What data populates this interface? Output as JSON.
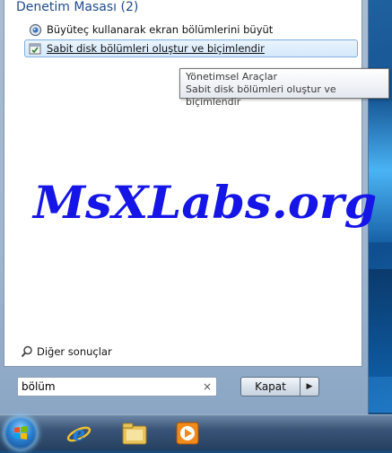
{
  "results": {
    "group_header": "Denetim Masası (2)",
    "items": [
      {
        "label": "Büyüteç kullanarak ekran bölümlerini büyüt",
        "icon": "magnifier-icon"
      },
      {
        "label": "Sabit disk bölümleri oluştur ve biçimlendir",
        "icon": "admin-tools-icon",
        "selected": true
      }
    ]
  },
  "tooltip": {
    "line1": "Yönetimsel Araçlar",
    "line2": "Sabit disk bölümleri oluştur ve biçimlendir"
  },
  "watermark": "MsXLabs.org",
  "more_results": "Diğer sonuçlar",
  "search": {
    "value": "bölüm",
    "clear_glyph": "×"
  },
  "shutdown": {
    "label": "Kapat",
    "arrow_glyph": "▶"
  },
  "taskbar": {
    "items": [
      "start-orb",
      "internet-explorer-icon",
      "explorer-folder-icon",
      "media-player-icon"
    ]
  },
  "colors": {
    "accent_header": "#1e4c8c",
    "selection_border": "#7daee0",
    "watermark": "#1515e8"
  }
}
